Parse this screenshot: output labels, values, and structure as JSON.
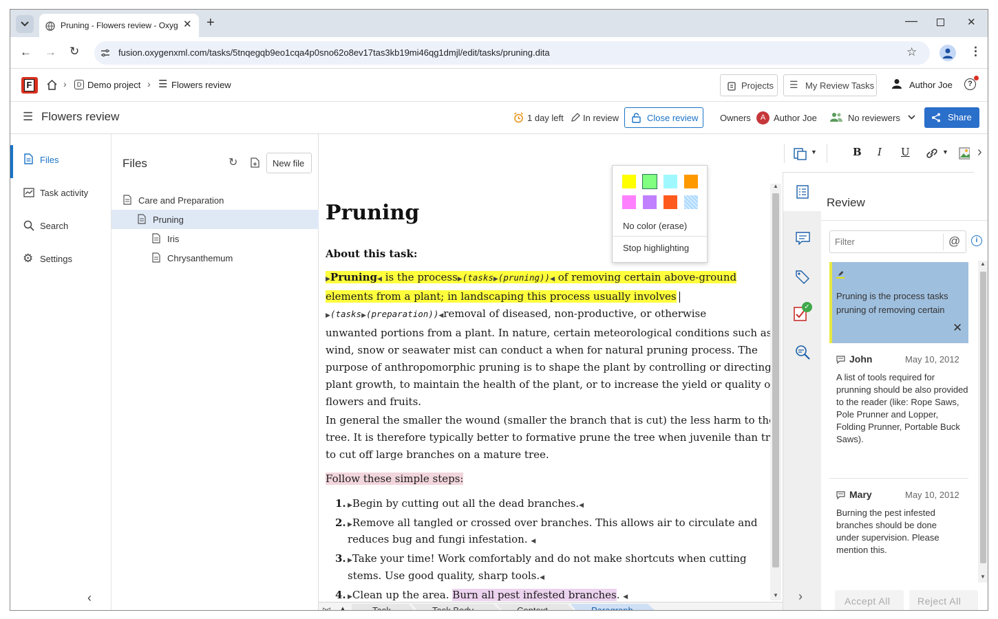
{
  "browser": {
    "tab_title": "Pruning - Flowers review - Oxyg",
    "url": "fusion.oxygenxml.com/tasks/5tnqegqb9eo1cqa4p0sno62o8ev17tas3kb19mi46qg1dmjl/edit/tasks/pruning.dita"
  },
  "header": {
    "logo": "F",
    "breadcrumb_project": "Demo project",
    "breadcrumb_project_badge": "D",
    "breadcrumb_task": "Flowers review",
    "projects_label": "Projects",
    "my_review_tasks_label": "My Review Tasks",
    "user_label": "Author Joe"
  },
  "task": {
    "title": "Flowers review",
    "time_left": "1 day left",
    "status": "In review",
    "close_review_label": "Close review",
    "owners_label": "Owners",
    "owner_initial": "A",
    "owner_name": "Author Joe",
    "reviewers_label": "No reviewers",
    "share_label": "Share"
  },
  "nav": {
    "items": [
      {
        "label": "Files"
      },
      {
        "label": "Task activity"
      },
      {
        "label": "Search"
      },
      {
        "label": "Settings"
      }
    ]
  },
  "files": {
    "title": "Files",
    "new_file_label": "New file",
    "tree": [
      {
        "label": "Care and Preparation"
      },
      {
        "label": "Pruning"
      },
      {
        "label": "Iris"
      },
      {
        "label": "Chrysanthemum"
      }
    ]
  },
  "highlight_menu": {
    "colors": [
      "#ffff00",
      "#80ff80",
      "#a0f8ff",
      "#ff9900",
      "#ff80ff",
      "#c080ff",
      "#ff5a1e",
      "#a8d8ff"
    ],
    "no_color_label": "No color (erase)",
    "stop_label": "Stop highlighting"
  },
  "document": {
    "title": "Pruning",
    "section_heading": "About this task:",
    "p1_bold": "Pruning",
    "p1_a": "is the process",
    "p1_tag1": "(tasks",
    "p1_tag2": "(pruning)",
    "p1_tag3": ")",
    "p1_b": "of removing certain above-ground",
    "p1_line2": "elements from a plant; in landscaping this process usually involves",
    "p1_tag4": "(tasks",
    "p1_tag5": "(preparation)",
    "p1_tag6": ")",
    "p1_c": "removal of diseased, non-productive, or otherwise",
    "p1_line4": "unwanted portions from a plant. In nature, certain meteorological conditions such as",
    "p1_line5": "wind, snow or seawater mist can conduct a when for natural pruning process. The",
    "p1_line6": "purpose of anthropomorphic pruning is to shape the plant by controlling or directing",
    "p1_line7": "plant growth, to maintain the health of the plant, or to increase the yield or quality of",
    "p1_line8": "flowers and fruits.",
    "p2_line1": "In general the smaller the wound (smaller the branch that is cut) the less harm to the",
    "p2_line2": "tree. It is therefore typically better to formative prune the tree when juvenile than try",
    "p2_line3": "to cut off large branches on a mature tree.",
    "steps_intro": "Follow these simple steps:",
    "step1_num": "1.",
    "step1": "Begin by cutting out all the dead branches.",
    "step2_num": "2.",
    "step2_line1": "Remove all tangled or crossed over branches. This allows air to circulate and",
    "step2_line2": "reduces bug and fungi infestation.",
    "step3_num": "3.",
    "step3_line1": "Take your time! Work comfortably and do not make shortcuts when cutting",
    "step3_line2": "stems. Use good quality, sharp tools.",
    "step4_num": "4.",
    "step4_a": "Clean up the area.",
    "step4_hl": "Burn all pest infested branches",
    "step4_b": "."
  },
  "breadcrumb_bar": {
    "items": [
      "Task",
      "Task Body",
      "Context",
      "Paragraph"
    ]
  },
  "review": {
    "title": "Review",
    "filter_placeholder": "Filter",
    "highlight_card_text": "Pruning is the process tasks pruning of removing certain",
    "comments": [
      {
        "author": "John",
        "date": "May 10, 2012",
        "text": "A list of tools required for prunning should be also provided to the reader (like: Rope Saws, Pole Prunner and Lopper,  Folding Prunner, Portable Buck Saws)."
      },
      {
        "author": "Mary",
        "date": "May 10, 2012",
        "text": "Burning the pest infested branches should be done under supervision. Please mention this."
      }
    ],
    "accept_all_label": "Accept All",
    "reject_all_label": "Reject All"
  },
  "colors": {
    "accent": "#1a73c8",
    "share_bg": "#2a6fca",
    "highlight_yellow": "#ffff3c",
    "highlight_card": "#9fbfde"
  }
}
